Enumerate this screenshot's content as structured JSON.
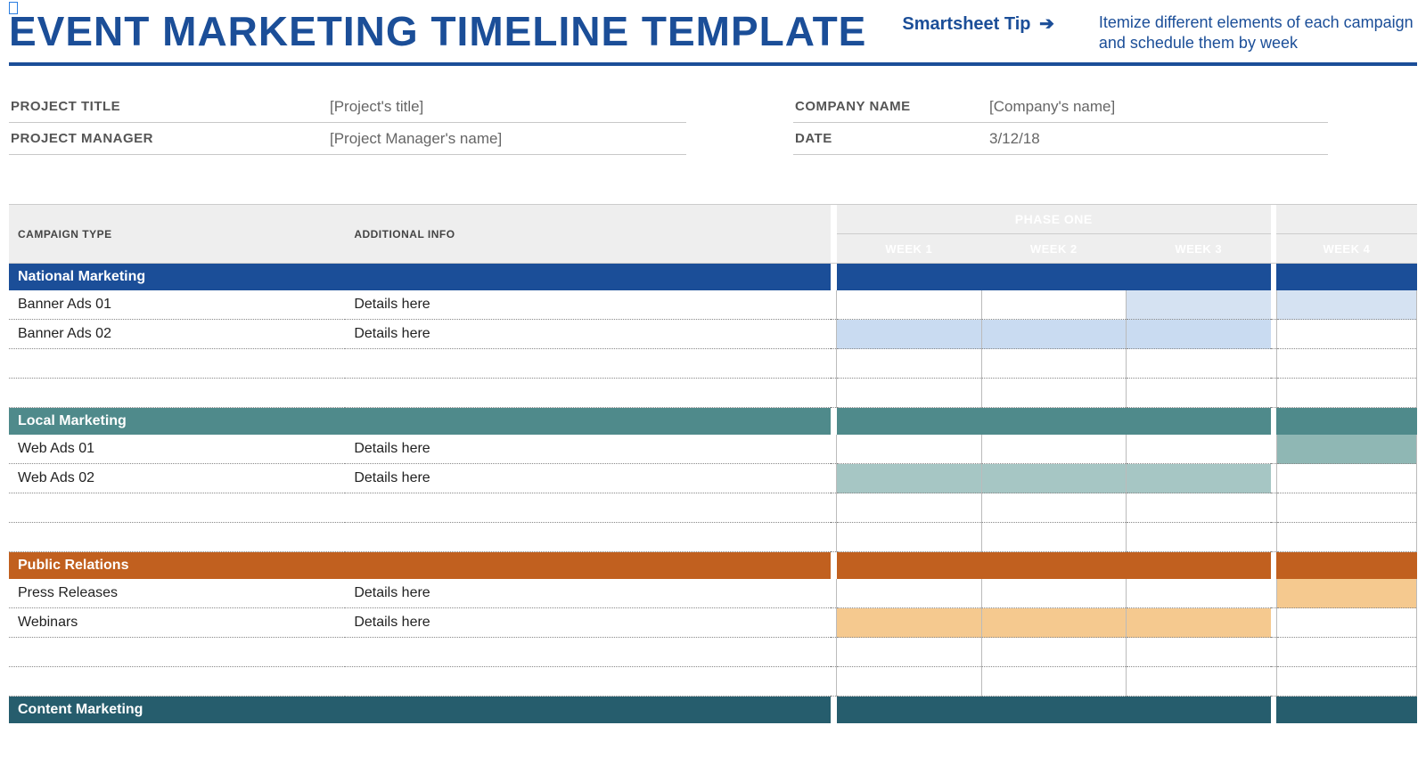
{
  "header": {
    "title": "EVENT MARKETING TIMELINE TEMPLATE",
    "tip_label": "Smartsheet Tip",
    "tip_arrow": "➔",
    "tip_text": "Itemize different elements of each campaign and schedule them by week"
  },
  "meta": {
    "left": [
      {
        "label": "PROJECT TITLE",
        "value": "[Project's title]"
      },
      {
        "label": "PROJECT MANAGER",
        "value": "[Project Manager's name]"
      }
    ],
    "right": [
      {
        "label": "COMPANY NAME",
        "value": "[Company's name]"
      },
      {
        "label": "DATE",
        "value": "3/12/18"
      }
    ]
  },
  "columns": {
    "campaign_type": "CAMPAIGN TYPE",
    "additional_info": "ADDITIONAL INFO",
    "phase": "PHASE ONE",
    "weeks": [
      "WEEK 1",
      "WEEK 2",
      "WEEK 3",
      "WEEK 4"
    ]
  },
  "sections": [
    {
      "name": "National Marketing",
      "color": "sec-blue",
      "rows": [
        {
          "campaign": "Banner Ads 01",
          "info": "Details here",
          "fills": [
            "",
            "",
            "f-blue-l",
            "f-blue-l"
          ]
        },
        {
          "campaign": "Banner Ads 02",
          "info": "Details here",
          "fills": [
            "f-blue-m",
            "f-blue-m",
            "f-blue-m",
            ""
          ]
        },
        {
          "campaign": "",
          "info": "",
          "fills": [
            "",
            "",
            "",
            ""
          ]
        },
        {
          "campaign": "",
          "info": "",
          "fills": [
            "",
            "",
            "",
            ""
          ]
        }
      ]
    },
    {
      "name": "Local Marketing",
      "color": "sec-teal",
      "rows": [
        {
          "campaign": "Web Ads 01",
          "info": "Details here",
          "fills": [
            "",
            "",
            "",
            "f-teal-m"
          ]
        },
        {
          "campaign": "Web Ads 02",
          "info": "Details here",
          "fills": [
            "f-teal-l",
            "f-teal-l",
            "f-teal-l",
            ""
          ]
        },
        {
          "campaign": "",
          "info": "",
          "fills": [
            "",
            "",
            "",
            ""
          ]
        },
        {
          "campaign": "",
          "info": "",
          "fills": [
            "",
            "",
            "",
            ""
          ]
        }
      ]
    },
    {
      "name": "Public Relations",
      "color": "sec-orange",
      "rows": [
        {
          "campaign": "Press Releases",
          "info": "Details here",
          "fills": [
            "",
            "",
            "",
            "f-orng-l"
          ]
        },
        {
          "campaign": "Webinars",
          "info": "Details here",
          "fills": [
            "f-orng-l",
            "f-orng-l",
            "f-orng-l",
            ""
          ]
        },
        {
          "campaign": "",
          "info": "",
          "fills": [
            "",
            "",
            "",
            ""
          ]
        },
        {
          "campaign": "",
          "info": "",
          "fills": [
            "",
            "",
            "",
            ""
          ]
        }
      ]
    },
    {
      "name": "Content Marketing",
      "color": "sec-dteal",
      "rows": []
    }
  ]
}
